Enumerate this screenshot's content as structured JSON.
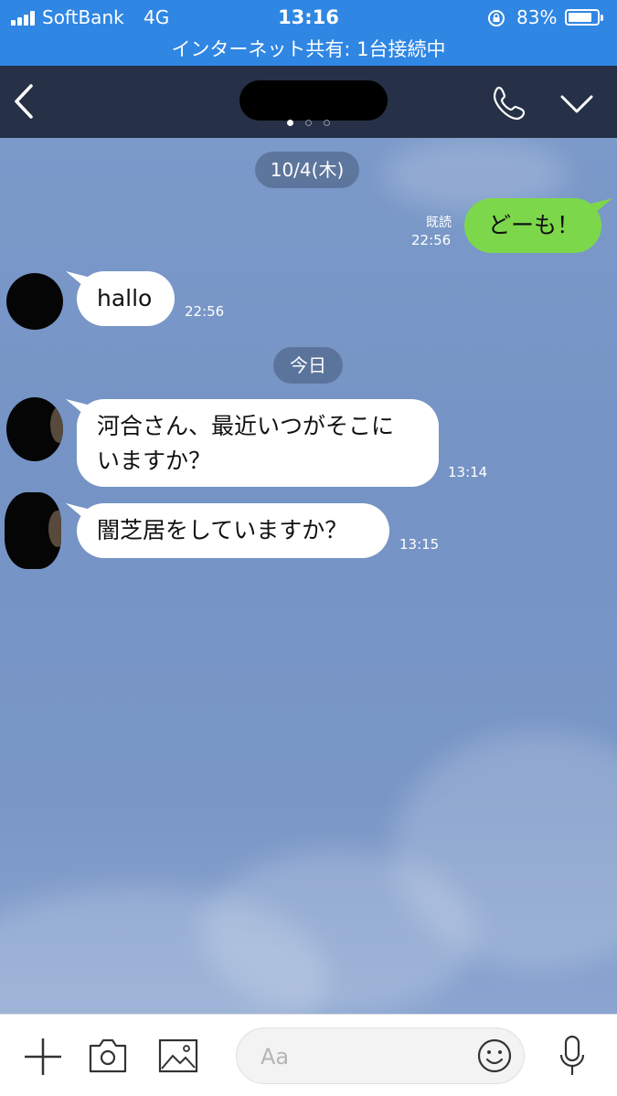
{
  "status_bar": {
    "carrier": "SoftBank",
    "network": "4G",
    "time": "13:16",
    "battery_percent": "83%",
    "battery_level": 0.83,
    "hotspot_text": "インターネット共有: 1台接続中"
  },
  "header": {
    "page_dot_count": 3,
    "active_page_dot": 0
  },
  "messages": [
    {
      "type": "date",
      "text": "10/4(木)"
    },
    {
      "type": "outgoing",
      "text": "どーも！",
      "read_label": "既読",
      "time": "22:56"
    },
    {
      "type": "incoming",
      "text": "hallo",
      "time": "22:56"
    },
    {
      "type": "date",
      "text": "今日"
    },
    {
      "type": "incoming",
      "line1": "河合さん、最近いつがそこに",
      "line2": "いますか？",
      "time": "13:14"
    },
    {
      "type": "incoming",
      "text": "闇芝居をしていますか？",
      "time": "13:15"
    }
  ],
  "input_bar": {
    "placeholder": "Aa"
  },
  "colors": {
    "status_bar_bg": "#2f86e3",
    "header_bg": "#263046",
    "outgoing_bubble": "#7cd84a",
    "incoming_bubble": "#ffffff",
    "chat_bg": "#7996c6"
  }
}
